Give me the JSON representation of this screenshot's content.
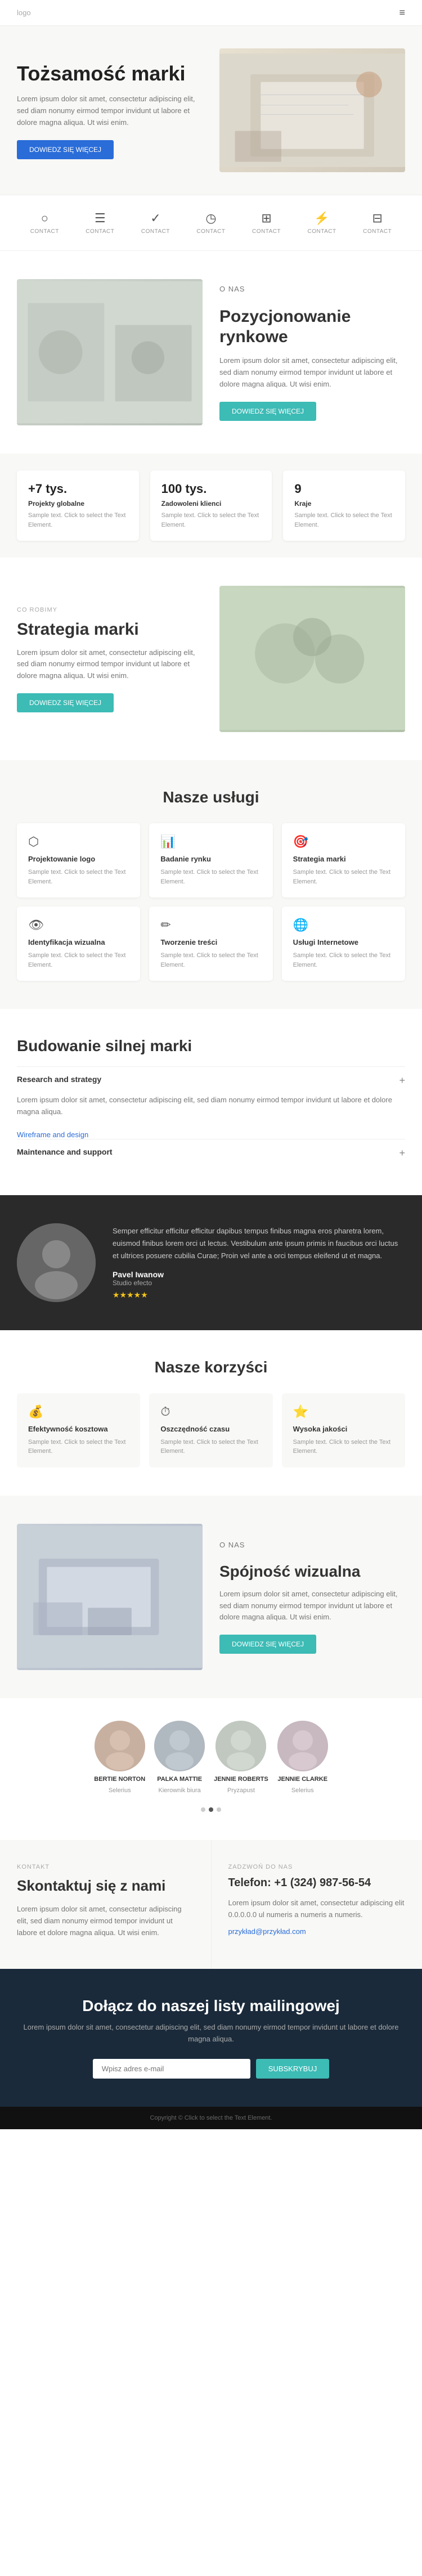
{
  "nav": {
    "logo": "logo",
    "hamburger_icon": "≡"
  },
  "hero": {
    "title": "Tożsamość marki",
    "description": "Lorem ipsum dolor sit amet, consectetur adipiscing elit, sed diam nonumy eirmod tempor invidunt ut labore et dolore magna aliqua. Ut wisi enim.",
    "button_label": "DOWIEDZ SIĘ WIĘCEJ"
  },
  "icons_row": {
    "items": [
      {
        "icon": "○",
        "label": "CONTACT"
      },
      {
        "icon": "☰",
        "label": "CONTACT"
      },
      {
        "icon": "✓",
        "label": "CONTACT"
      },
      {
        "icon": "◷",
        "label": "CONTACT"
      },
      {
        "icon": "⊞",
        "label": "CONTACT"
      },
      {
        "icon": "⚡",
        "label": "CONTACT"
      },
      {
        "icon": "⊟",
        "label": "CONTACT"
      }
    ]
  },
  "positioning": {
    "label": "O NAS",
    "title": "Pozycjonowanie rynkowe",
    "description": "Lorem ipsum dolor sit amet, consectetur adipiscing elit, sed diam nonumy eirmod tempor invidunt ut labore et dolore magna aliqua. Ut wisi enim.",
    "button_label": "DOWIEDZ SIĘ WIĘCEJ"
  },
  "stats": [
    {
      "number": "+7 tys.",
      "label": "Projekty globalne",
      "description": "Sample text. Click to select the Text Element."
    },
    {
      "number": "100 tys.",
      "label": "Zadowoleni klienci",
      "description": "Sample text. Click to select the Text Element."
    },
    {
      "number": "9",
      "label": "Kraje",
      "description": "Sample text. Click to select the Text Element."
    }
  ],
  "strategy": {
    "co_robimy": "CO ROBIMY",
    "title": "Strategia marki",
    "description": "Lorem ipsum dolor sit amet, consectetur adipiscing elit, sed diam nonumy eirmod tempor invidunt ut labore et dolore magna aliqua. Ut wisi enim.",
    "button_label": "DOWIEDZ SIĘ WIĘCEJ"
  },
  "services": {
    "title": "Nasze usługi",
    "items": [
      {
        "icon": "⬡",
        "title": "Projektowanie logo",
        "description": "Sample text. Click to select the Text Element."
      },
      {
        "icon": "📊",
        "title": "Badanie rynku",
        "description": "Sample text. Click to select the Text Element."
      },
      {
        "icon": "🎯",
        "title": "Strategia marki",
        "description": "Sample text. Click to select the Text Element."
      },
      {
        "icon": "👁",
        "title": "Identyfikacja wizualna",
        "description": "Sample text. Click to select the Text Element."
      },
      {
        "icon": "✏",
        "title": "Tworzenie treści",
        "description": "Sample text. Click to select the Text Element."
      },
      {
        "icon": "🌐",
        "title": "Usługi Internetowe",
        "description": "Sample text. Click to select the Text Element."
      }
    ]
  },
  "building": {
    "title": "Budowanie silnej marki",
    "accordion": [
      {
        "title": "Research and strategy",
        "active": true,
        "content": "Lorem ipsum dolor sit amet, consectetur adipiscing elit, sed diam nonumy eirmod tempor invidunt ut labore et dolore magna aliqua.",
        "links": [
          "Wireframe and design",
          "Maintenance and support"
        ]
      }
    ]
  },
  "testimonial": {
    "text": "Semper efficitur efficitur efficitur dapibus tempus finibus magna eros pharetra lorem, euismod finibus lorem orci ut lectus. Vestibulum ante ipsum primis in faucibus orci luctus et ultrices posuere cubilia Curae; Proin vel ante a orci tempus eleifend ut et magna.",
    "name": "Pavel Iwanow",
    "role": "Studio efecto",
    "stars": "★★★★★"
  },
  "benefits": {
    "title": "Nasze korzyści",
    "items": [
      {
        "icon": "💰",
        "title": "Efektywność kosztowa",
        "description": "Sample text. Click to select the Text Element."
      },
      {
        "icon": "⏱",
        "title": "Oszczędność czasu",
        "description": "Sample text. Click to select the Text Element."
      },
      {
        "icon": "⭐",
        "title": "Wysoka jakości",
        "description": "Sample text. Click to select the Text Element."
      }
    ]
  },
  "visual": {
    "label": "O NAS",
    "title": "Spójność wizualna",
    "description": "Lorem ipsum dolor sit amet, consectetur adipiscing elit, sed diam nonumy eirmod tempor invidunt ut labore et dolore magna aliqua. Ut wisi enim.",
    "button_label": "DOWIEDZ SIĘ WIĘCEJ"
  },
  "team": {
    "members": [
      {
        "name": "BERTIE NORTON",
        "role": "Selerius"
      },
      {
        "name": "PALKA MATTIE",
        "role": "Kierownik biura"
      },
      {
        "name": "JENNIE ROBERTS",
        "role": "Pryzapust"
      },
      {
        "name": "JENNIE CLARKE",
        "role": "Selerius"
      }
    ],
    "page_dots": [
      0,
      1,
      2
    ],
    "active_dot": 1
  },
  "contact": {
    "label": "KONTAKT",
    "title": "Skontaktuj się z nami",
    "description": "Lorem ipsum dolor sit amet, consectetur adipiscing elit, sed diam nonumy eirmod tempor invidunt ut labore et dolore magna aliqua. Ut wisi enim.",
    "phone_label": "ZADZWOŃ DO NAS",
    "phone": "Telefon: +1 (324) 987-56-54",
    "address_desc": "Lorem ipsum dolor sit amet, consectetur adipiscing elit 0.0.0.0.0 ul numeris a numeris a numeris.",
    "email": "przykład@przykład.com"
  },
  "newsletter": {
    "title": "Dołącz do naszej listy mailingowej",
    "description": "Lorem ipsum dolor sit amet, consectetur adipiscing elit, sed diam nonumy eirmod tempor invidunt ut labore et dolore magna aliqua.",
    "input_placeholder": "Wpisz adres e-mail",
    "button_label": "SUBSKRYBUJ"
  },
  "footer": {
    "text": "Copyright © Click to select the Text Element."
  }
}
